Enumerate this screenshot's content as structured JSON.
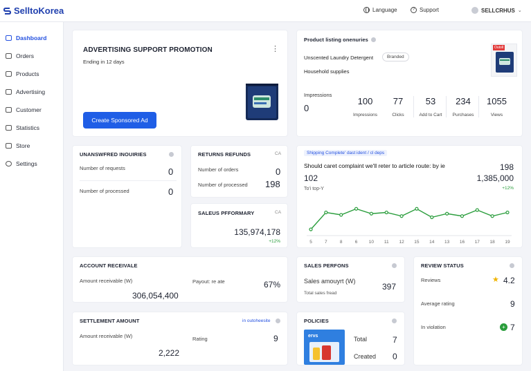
{
  "app": {
    "logo": "SelltoKorea"
  },
  "topbar": {
    "language": "Language",
    "support": "Support",
    "user": "SELLCRHUS"
  },
  "sidebar": {
    "items": [
      {
        "label": "Dashboard",
        "icon": "dashboard-icon"
      },
      {
        "label": "Orders",
        "icon": "orders-icon"
      },
      {
        "label": "Products",
        "icon": "products-icon"
      },
      {
        "label": "Advertising",
        "icon": "advertising-icon"
      },
      {
        "label": "Customer",
        "icon": "customer-icon"
      },
      {
        "label": "Statistics",
        "icon": "statistics-icon"
      },
      {
        "label": "Store",
        "icon": "store-icon"
      },
      {
        "label": "Settings",
        "icon": "settings-icon"
      }
    ]
  },
  "promo": {
    "title": "ADVERTISING SUPPORT PROMOTION",
    "subtitle": "Ending in 12 days",
    "button": "Create Sponsored Ad"
  },
  "listing": {
    "title": "Product listing onenuries",
    "product": "Unscented Laundry Detergent",
    "badge": "Branded",
    "category": "Household supplies",
    "impressions_label": "Impressions",
    "impressions_value": "0",
    "stats": [
      {
        "value": "100",
        "label": "Impressions"
      },
      {
        "value": "77",
        "label": "Clicks"
      },
      {
        "value": "53",
        "label": "Add to Cart"
      },
      {
        "value": "234",
        "label": "Purchases"
      },
      {
        "value": "1055",
        "label": "Views"
      }
    ],
    "thumb_tag": "Outoll"
  },
  "inquiries": {
    "title": "UNANSWFRED INOUIRIES",
    "rows": [
      {
        "label": "Number of requests",
        "value": "0"
      },
      {
        "label": "Number of processed",
        "value": "0"
      }
    ]
  },
  "returns": {
    "title": "RETURNS REFUNDS",
    "tag": "CA",
    "rows": [
      {
        "label": "Number of orders",
        "value": "0"
      },
      {
        "label": "Number of processed",
        "value": "198"
      }
    ]
  },
  "sales_perf": {
    "title": "SALEUS PFFORMARY",
    "tag": "CA",
    "value": "135,974,178",
    "change": "+12%"
  },
  "shipping": {
    "badge": "Shipping Complete' dast ident / cl deps",
    "headline": "Should caret complaint we'll reter to article route: by ie",
    "right_value": "198",
    "left_value": "102",
    "right_value2": "1,385,000",
    "sub": "To'i top-Y",
    "change": "+12%"
  },
  "chart_data": {
    "type": "line",
    "x": [
      "5",
      "7",
      "8",
      "6",
      "10",
      "11",
      "12",
      "15",
      "14",
      "13",
      "16",
      "17",
      "18",
      "19"
    ],
    "series": [
      {
        "values": [
          4,
          18,
          16,
          21,
          17,
          18,
          15,
          21,
          14,
          17,
          15,
          20,
          15,
          18
        ]
      }
    ],
    "color": "#2a9d3c",
    "grid": false
  },
  "account": {
    "title": "ACCOUNT RECEIVALE",
    "label": "Amount receivable (W)",
    "value": "306,054,400",
    "payout_label": "Payout: re ate",
    "payout_value": "67%"
  },
  "sales_perfons": {
    "title": "SALES PERFONS",
    "label": "Sales amouyrt",
    "unit": "(W)",
    "sub": "Total sales fread",
    "value": "397"
  },
  "review": {
    "title": "REVIEW STATUS",
    "rows": [
      {
        "label": "Reviews",
        "value": "4.2"
      },
      {
        "label": "Average rating",
        "value": "9"
      },
      {
        "label": "In violation",
        "value": "7"
      }
    ]
  },
  "settlement": {
    "title": "SETTLEMENT AMOUNT",
    "link": "in outoheesite",
    "label": "Amount receivable (W)",
    "value": "2,222",
    "rating_label": "Rating",
    "rating_value": "9"
  },
  "policies": {
    "title": "POLICIES",
    "thumb_text": "ervs",
    "rows": [
      {
        "label": "Total",
        "value": "7"
      },
      {
        "label": "Created",
        "value": "0"
      }
    ]
  }
}
